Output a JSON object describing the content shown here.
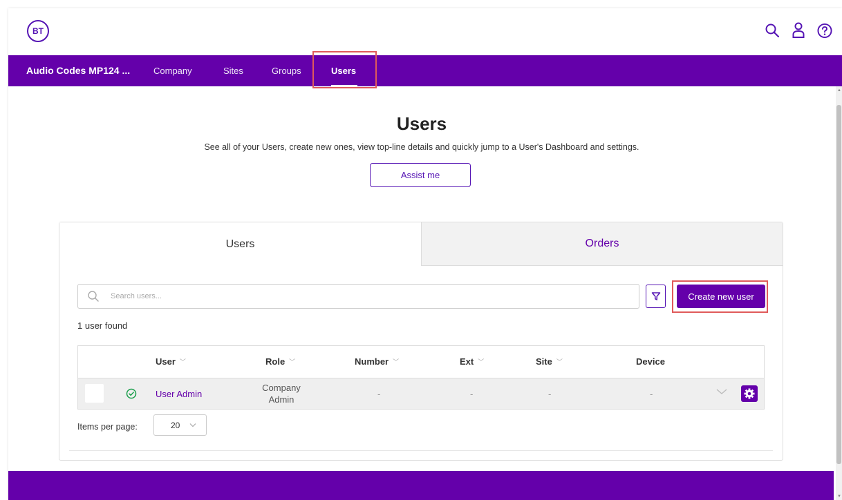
{
  "brand": {
    "logo_text": "BT",
    "accent": "#6400aa",
    "highlight": "#e05a5a"
  },
  "header_icons": [
    "search-icon",
    "user-icon",
    "help-icon"
  ],
  "nav": {
    "app_name": "Audio Codes MP124 ...",
    "items": [
      {
        "label": "Company"
      },
      {
        "label": "Sites"
      },
      {
        "label": "Groups"
      },
      {
        "label": "Users",
        "active": true
      }
    ]
  },
  "page": {
    "title": "Users",
    "description": "See all of your Users, create new ones, view top-line details and quickly jump to a User's Dashboard and settings.",
    "assist_label": "Assist me"
  },
  "tabs": [
    {
      "label": "Users",
      "active": true
    },
    {
      "label": "Orders",
      "active": false
    }
  ],
  "toolbar": {
    "search_placeholder": "Search users...",
    "create_label": "Create new user"
  },
  "result_count": "1 user found",
  "table": {
    "columns": [
      {
        "label": "User",
        "sortable": true
      },
      {
        "label": "Role",
        "sortable": true
      },
      {
        "label": "Number",
        "sortable": true
      },
      {
        "label": "Ext",
        "sortable": true
      },
      {
        "label": "Site",
        "sortable": true
      },
      {
        "label": "Device",
        "sortable": false
      }
    ],
    "rows": [
      {
        "status": "active",
        "user": "User Admin",
        "role_line1": "Company",
        "role_line2": "Admin",
        "number": "-",
        "ext": "-",
        "site": "-",
        "device": "-"
      }
    ]
  },
  "pagination": {
    "items_per_page_label": "Items per page:",
    "items_per_page_value": "20"
  }
}
